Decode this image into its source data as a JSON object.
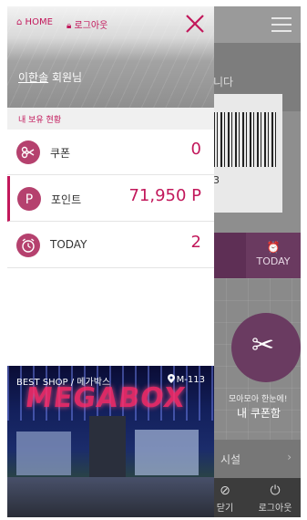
{
  "background": {
    "banner_text": "니다",
    "barcode_number": "3",
    "today_tab_label": "TODAY",
    "coupon_subtitle": "모아모아 한눈에!",
    "coupon_title": "내 쿠폰함",
    "facility_label": "시설",
    "bottom_partial_label": "닫기",
    "bottom_logout_label": "로그아웃"
  },
  "drawer": {
    "home_label": "HOME",
    "logout_label": "로그아웃",
    "member_name": "이한솔",
    "member_suffix": " 회원님",
    "holdings_title": "내 보유 현황",
    "rows": [
      {
        "label": "쿠폰",
        "value": "0",
        "icon": "scissors-icon"
      },
      {
        "label": "포인트",
        "value": "71,950 P",
        "icon": "point-p-icon"
      },
      {
        "label": "TODAY",
        "value": "2",
        "icon": "alarm-clock-icon"
      }
    ],
    "best_shop_label": "BEST SHOP / 메가박스",
    "best_shop_location": "M-113",
    "shop_sign_text": "MEGABOX"
  },
  "colors": {
    "accent": "#c2185b",
    "row_icon": "#b5416e",
    "bg_tab": "#5e2f55"
  }
}
